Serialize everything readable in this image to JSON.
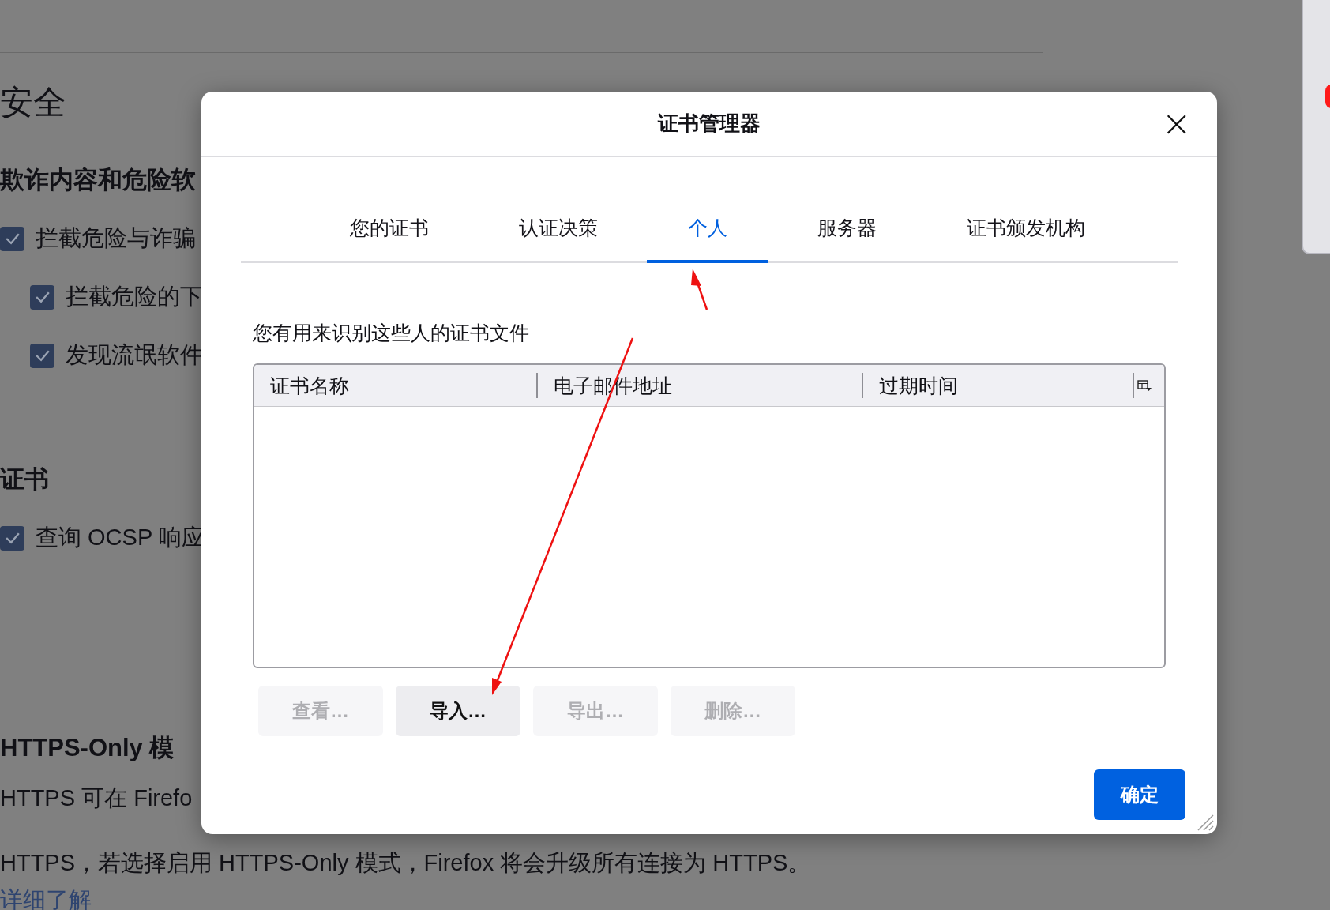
{
  "background_page": {
    "top_heading": "安全",
    "sections": [
      {
        "heading": "欺诈内容和危险软",
        "options": [
          {
            "label": "拦截危险与诈骗",
            "checked": true,
            "children": [
              {
                "label": "拦截危险的下",
                "checked": true
              },
              {
                "label": "发现流氓软件",
                "checked": true
              }
            ]
          }
        ]
      },
      {
        "heading": "证书",
        "options": [
          {
            "label": "查询 OCSP 响应",
            "checked": true
          }
        ]
      },
      {
        "heading": "HTTPS-Only 模",
        "lines": [
          "HTTPS 可在 Firefo",
          "HTTPS，若选择启用 HTTPS-Only 模式，Firefox 将会升级所有连接为 HTTPS。"
        ],
        "link": "详细了解"
      }
    ]
  },
  "dialog": {
    "title": "证书管理器",
    "close": "×",
    "tabs": [
      {
        "label": "您的证书",
        "selected": false
      },
      {
        "label": "认证决策",
        "selected": false
      },
      {
        "label": "个人",
        "selected": true
      },
      {
        "label": "服务器",
        "selected": false
      },
      {
        "label": "证书颁发机构",
        "selected": false
      }
    ],
    "description": "您有用来识别这些人的证书文件",
    "table": {
      "columns": [
        "证书名称",
        "电子邮件地址",
        "过期时间"
      ]
    },
    "buttons": [
      {
        "label": "查看…",
        "disabled": true
      },
      {
        "label": "导入…",
        "disabled": false
      },
      {
        "label": "导出…",
        "disabled": true
      },
      {
        "label": "删除…",
        "disabled": true
      }
    ],
    "ok_button": "确定"
  }
}
